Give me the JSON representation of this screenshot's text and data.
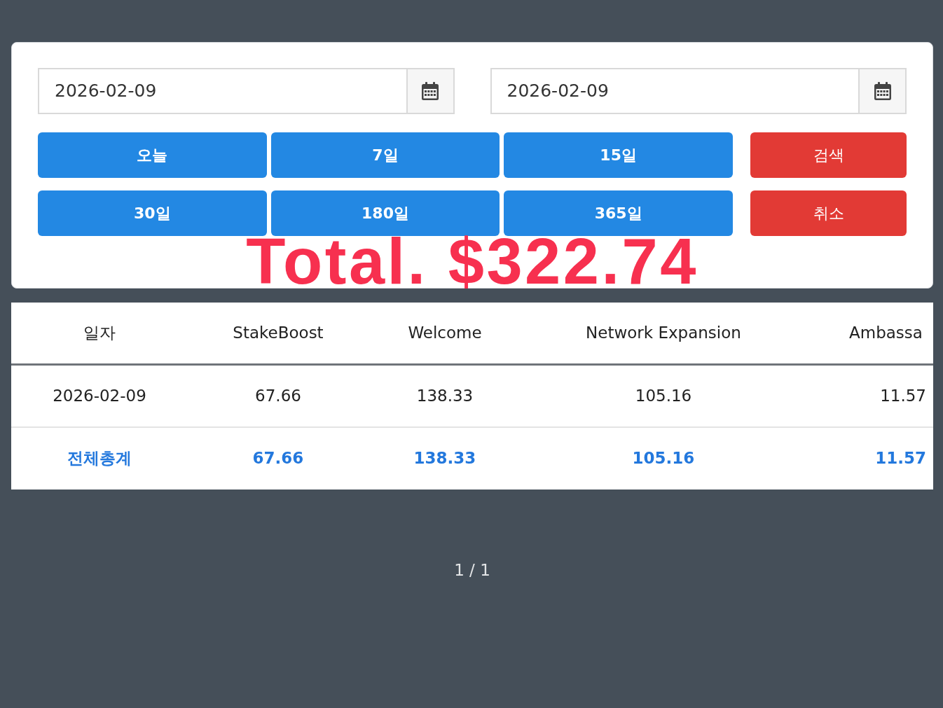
{
  "date_range": [
    {
      "value": "2026-02-09"
    },
    {
      "value": "2026-02-09"
    }
  ],
  "period_buttons": [
    "오늘",
    "7일",
    "15일",
    "30일",
    "180일",
    "365일"
  ],
  "action_buttons": [
    "검색",
    "취소"
  ],
  "total": "Total. $322.74",
  "table": {
    "columns": [
      "일자",
      "StakeBoost",
      "Welcome",
      "Network Expansion",
      "Ambassa"
    ],
    "rows": [
      {
        "kind": "data",
        "cells": [
          "2026-02-09",
          "67.66",
          "138.33",
          "105.16",
          "11.57"
        ]
      },
      {
        "kind": "total",
        "cells": [
          "전체총계",
          "67.66",
          "138.33",
          "105.16",
          "11.57"
        ]
      }
    ]
  },
  "pagination": "1 / 1"
}
